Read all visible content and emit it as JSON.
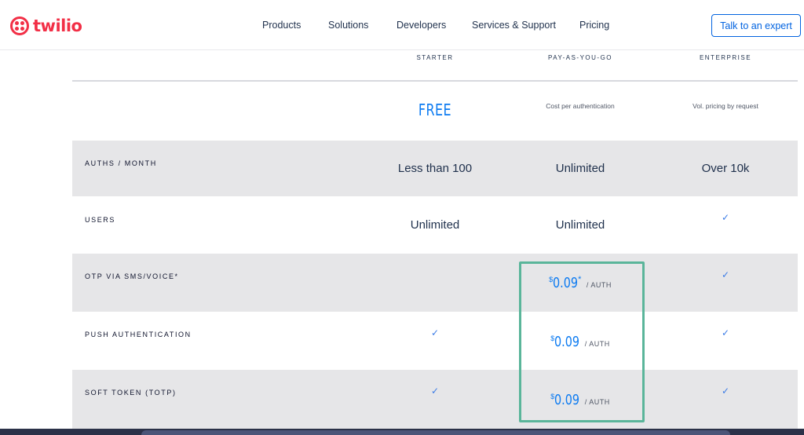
{
  "nav": {
    "logo_text": "twilio",
    "links": [
      "Products",
      "Solutions",
      "Developers",
      "Services & Support",
      "Pricing"
    ],
    "cta": "Talk to an expert"
  },
  "plans": {
    "headers": [
      "STARTER",
      "PAY-AS-YOU-GO",
      "ENTERPRISE"
    ],
    "starter_price": "FREE",
    "payg_note": "Cost per authentication",
    "enterprise_note": "Vol. pricing by request"
  },
  "rows": [
    {
      "label": "AUTHS / MONTH",
      "starter": "Less than 100",
      "payg": "Unlimited",
      "enterprise": "Over 10k"
    },
    {
      "label": "USERS",
      "starter": "Unlimited",
      "payg": "Unlimited",
      "enterprise": "✓"
    },
    {
      "label": "OTP VIA SMS/VOICE*",
      "starter": "",
      "payg_currency": "$",
      "payg_amount": "0.09",
      "payg_star": "*",
      "payg_unit": "/ AUTH",
      "enterprise": "✓"
    },
    {
      "label": "PUSH AUTHENTICATION",
      "starter": "✓",
      "payg_currency": "$",
      "payg_amount": "0.09",
      "payg_unit": "/ AUTH",
      "enterprise": "✓"
    },
    {
      "label": "SOFT TOKEN (TOTP)",
      "starter": "✓",
      "payg_currency": "$",
      "payg_amount": "0.09",
      "payg_unit": "/ AUTH",
      "enterprise": "✓"
    }
  ],
  "icons": {
    "check": "check-icon",
    "logo": "twilio-logo-icon"
  },
  "colors": {
    "brand": "#f22f46",
    "link": "#0263e0",
    "price": "#0d7bf1",
    "highlight": "#5ab59a"
  }
}
